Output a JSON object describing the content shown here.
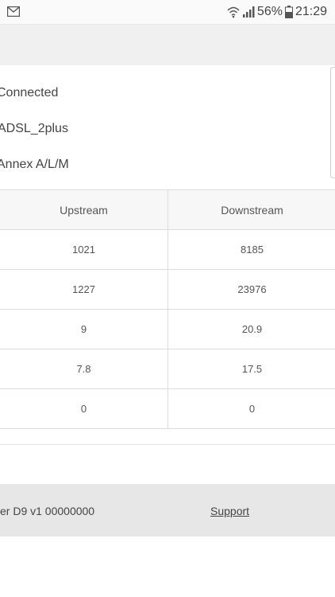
{
  "status_bar": {
    "battery": "56%",
    "time": "21:29",
    "icons": [
      "mail-icon",
      "wifi-icon",
      "signal-icon",
      "battery-icon"
    ]
  },
  "connection_info": {
    "status": "Connected",
    "mode": "ADSL_2plus",
    "annex": "Annex A/L/M"
  },
  "stats_table": {
    "headers": [
      "Upstream",
      "Downstream"
    ],
    "rows": [
      [
        "1021",
        "8185"
      ],
      [
        "1227",
        "23976"
      ],
      [
        "9",
        "20.9"
      ],
      [
        "7.8",
        "17.5"
      ],
      [
        "0",
        "0"
      ]
    ]
  },
  "footer": {
    "device_text": "er D9 v1 00000000",
    "support_label": "Support"
  }
}
